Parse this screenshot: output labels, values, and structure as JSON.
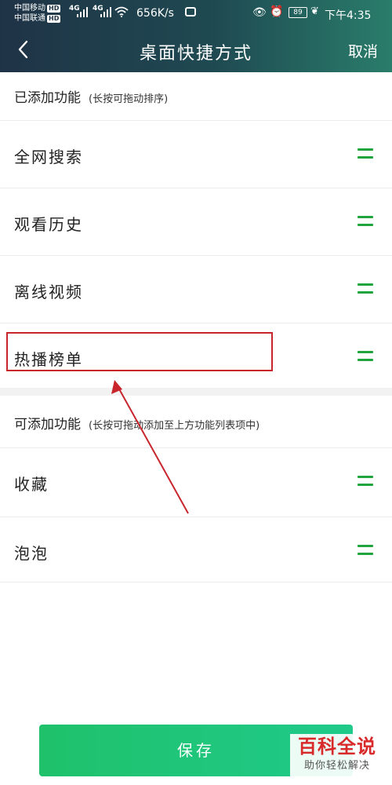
{
  "status_bar": {
    "carrier1": "中国移动",
    "carrier2": "中国联通",
    "hd": "HD",
    "net1": "4G",
    "net2": "4G",
    "speed": "656K/s",
    "battery": "89",
    "time": "下午4:35"
  },
  "header": {
    "title": "桌面快捷方式",
    "cancel": "取消"
  },
  "added": {
    "title": "已添加功能",
    "hint": "(长按可拖动排序)",
    "items": [
      "全网搜索",
      "观看历史",
      "离线视频",
      "热播榜单"
    ]
  },
  "available": {
    "title": "可添加功能",
    "hint": "(长按可拖动添加至上方功能列表项中)",
    "items": [
      "收藏",
      "泡泡"
    ]
  },
  "save_label": "保存",
  "watermark": {
    "title": "百科全说",
    "subtitle": "助你轻松解决"
  },
  "colors": {
    "accent_green": "#21a43d",
    "highlight_red": "#c8252c"
  }
}
